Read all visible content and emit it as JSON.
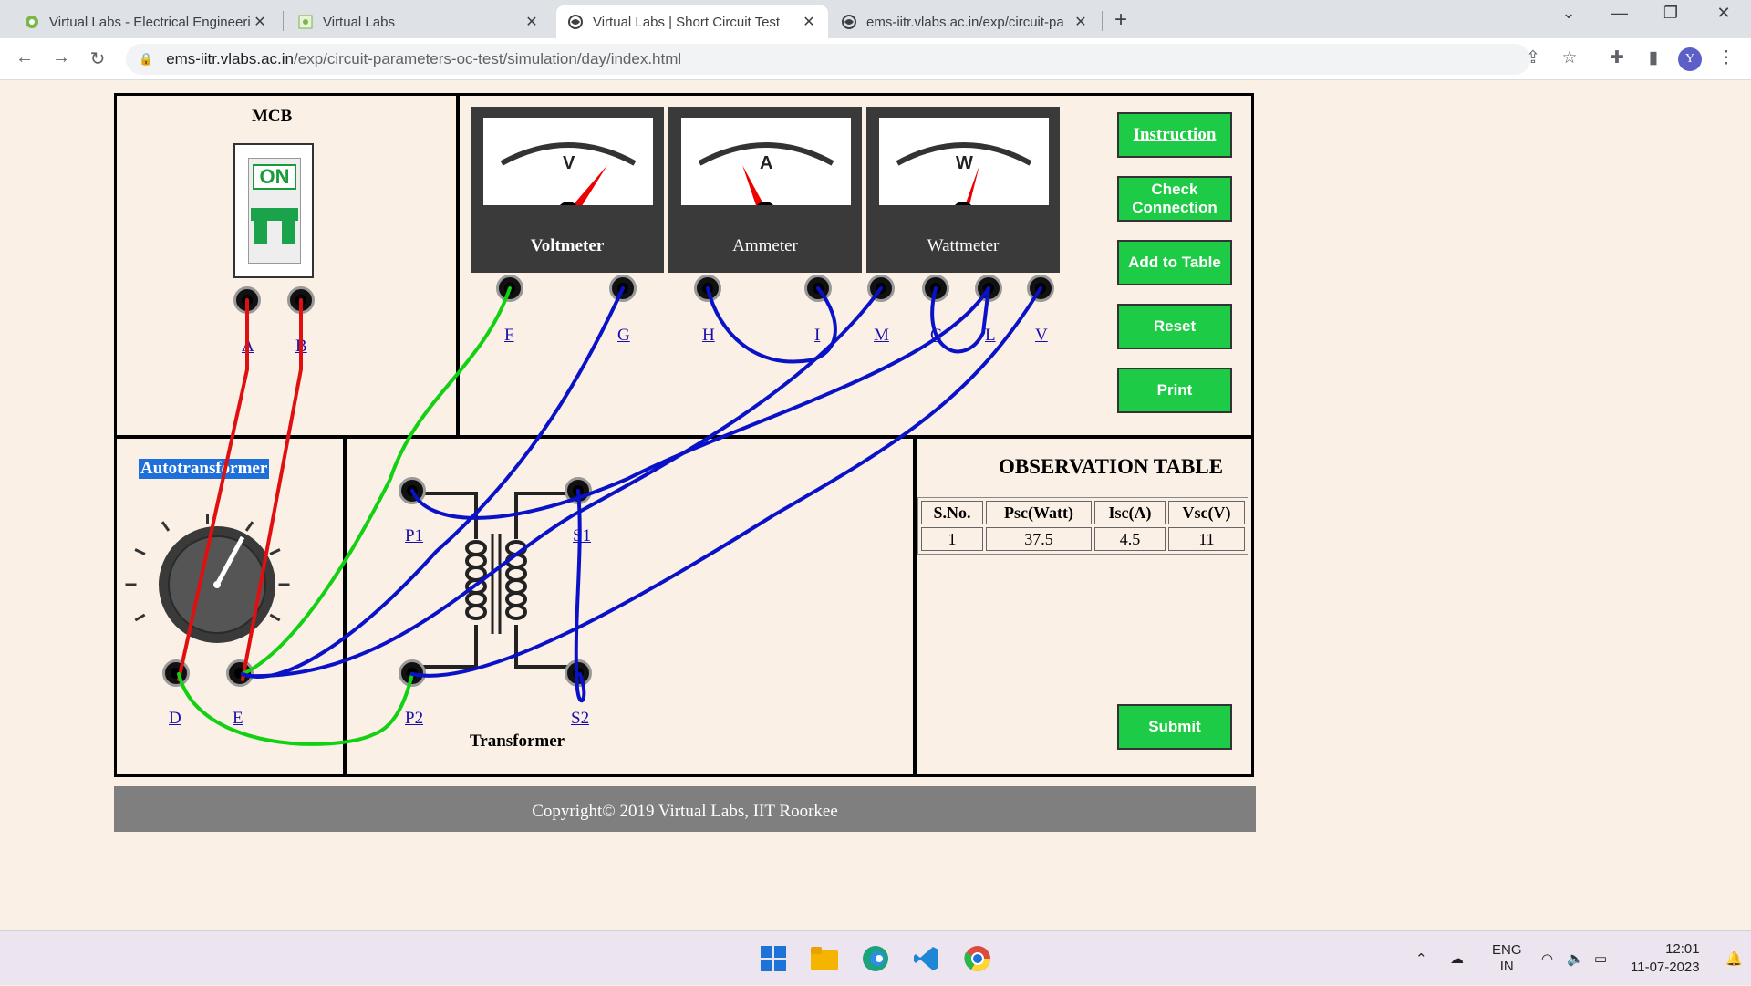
{
  "browser": {
    "tabs": [
      {
        "title": "Virtual Labs - Electrical Engineeri",
        "favicon": "virtual-labs-logo-icon",
        "active": false
      },
      {
        "title": "Virtual Labs",
        "favicon": "virtual-labs-logo-icon",
        "active": false
      },
      {
        "title": "Virtual Labs | Short Circuit Test",
        "favicon": "globe-icon",
        "active": true
      },
      {
        "title": "ems-iitr.vlabs.ac.in/exp/circuit-pa",
        "favicon": "globe-icon",
        "active": false
      }
    ],
    "new_tab": "+",
    "url_host": "ems-iitr.vlabs.ac.in",
    "url_path": "/exp/circuit-parameters-oc-test/simulation/day/index.html",
    "profile_initial": "Y"
  },
  "sim": {
    "mcb": {
      "title": "MCB",
      "state": "ON",
      "terminals": [
        "A",
        "B"
      ]
    },
    "meters": [
      {
        "symbol": "V",
        "label": "Voltmeter",
        "terminals": [
          "F",
          "G"
        ]
      },
      {
        "symbol": "A",
        "label": "Ammeter",
        "terminals": [
          "H",
          "I"
        ]
      },
      {
        "symbol": "W",
        "label": "Wattmeter",
        "terminals": [
          "M",
          "C",
          "L",
          "V"
        ]
      }
    ],
    "buttons": {
      "instruction": "Instruction",
      "check": "Check Connection",
      "add": "Add to Table",
      "reset": "Reset",
      "print": "Print",
      "submit": "Submit"
    },
    "autotransformer": {
      "title": "Autotransformer",
      "terminals": [
        "D",
        "E"
      ]
    },
    "transformer": {
      "title": "Transformer",
      "terminals": [
        "P1",
        "S1",
        "P2",
        "S2"
      ]
    },
    "observation": {
      "title": "OBSERVATION TABLE",
      "headers": [
        "S.No.",
        "Psc(Watt)",
        "Isc(A)",
        "Vsc(V)"
      ],
      "rows": [
        [
          "1",
          "37.5",
          "4.5",
          "11"
        ]
      ]
    },
    "wire_colors": {
      "red": "#e01010",
      "green": "#12d012",
      "blue": "#0a12c8"
    }
  },
  "footer": "Copyright© 2019 Virtual Labs, IIT Roorkee",
  "taskbar": {
    "lang": "ENG",
    "region": "IN",
    "time": "12:01",
    "date": "11-07-2023"
  }
}
